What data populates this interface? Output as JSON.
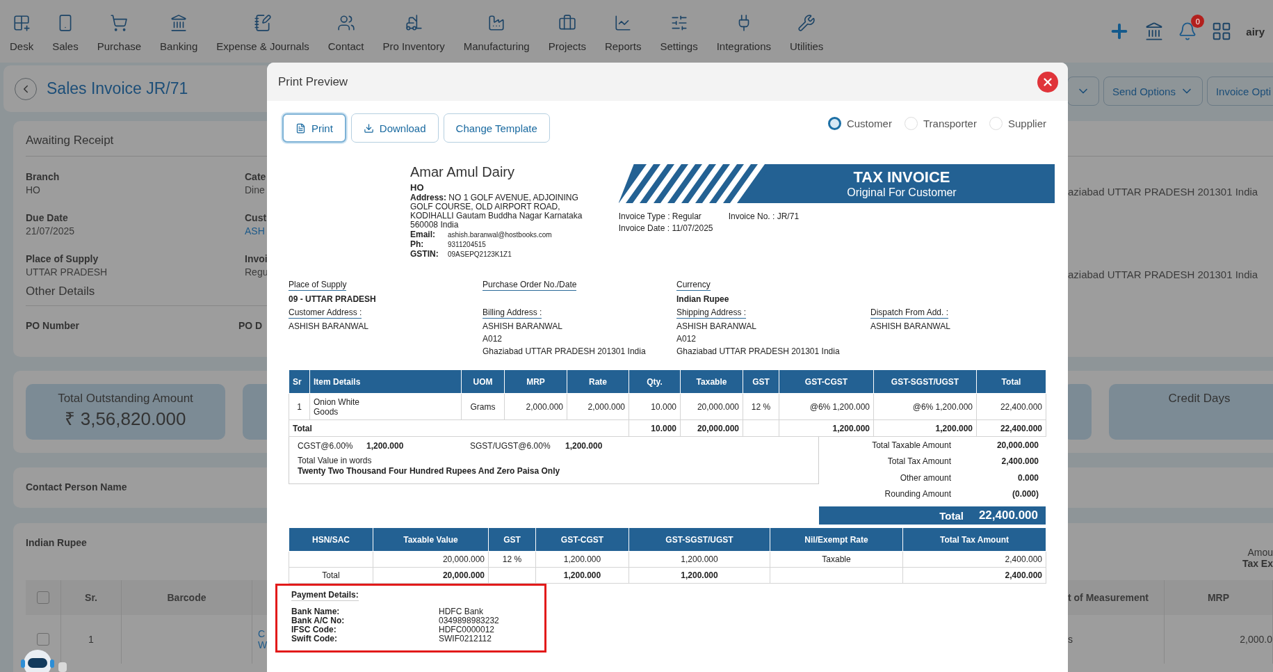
{
  "nav": {
    "items": [
      {
        "label": "Desk"
      },
      {
        "label": "Sales"
      },
      {
        "label": "Purchase"
      },
      {
        "label": "Banking"
      },
      {
        "label": "Expense & Journals"
      },
      {
        "label": "Contact"
      },
      {
        "label": "Pro Inventory"
      },
      {
        "label": "Manufacturing"
      },
      {
        "label": "Projects"
      },
      {
        "label": "Reports"
      },
      {
        "label": "Settings"
      },
      {
        "label": "Integrations"
      },
      {
        "label": "Utilities"
      }
    ],
    "notification_count": "0",
    "user": "airy"
  },
  "page": {
    "title": "Sales Invoice JR/71",
    "header_buttons": [
      "Send Options",
      "Invoice Opti"
    ],
    "details": {
      "status": "Awaiting Receipt",
      "fields": [
        {
          "label": "Branch",
          "value": "HO",
          "link": false
        },
        {
          "label": "Cate",
          "value": "Dine",
          "link": false
        },
        {
          "label": "Due Date",
          "value": "21/07/2025",
          "link": false
        },
        {
          "label": "Cust",
          "value": "ASH",
          "link": true
        },
        {
          "label": "Place of Supply",
          "value": "UTTAR PRADESH",
          "link": false
        },
        {
          "label": "Invoi",
          "value": "Regu",
          "link": false
        }
      ],
      "address_lines": [
        "aziabad UTTAR PRADESH 201301 India",
        "aziabad UTTAR PRADESH 201301 India"
      ],
      "other_details": "Other Details",
      "other_fields": [
        "PO Number",
        "PO D"
      ]
    },
    "summary_cards": [
      {
        "label": "Total Outstanding Amount",
        "value": "₹ 3,56,820.000"
      },
      {
        "label": "Credit Days"
      }
    ],
    "contact_label": "Contact Person Name",
    "currency": "Indian Rupee",
    "amount_labels": [
      "Amou",
      "Tax Ex"
    ],
    "items_table": {
      "header_checked": false,
      "left_columns": [
        "Sr.",
        "Barcode"
      ],
      "right_columns": [
        "t of Measurement",
        "MRP"
      ],
      "rows": [
        {
          "checked": false,
          "sr": "1",
          "column_3": [
            "C",
            "W"
          ],
          "right_cells": [
            "s",
            "2,000.0"
          ]
        }
      ]
    }
  },
  "modal": {
    "title": "Print Preview",
    "actions": [
      {
        "label": "Print",
        "focused": true
      },
      {
        "label": "Download",
        "focused": false
      },
      {
        "label": "Change Template",
        "focused": false
      }
    ],
    "copy_options": [
      {
        "label": "Customer",
        "selected": true
      },
      {
        "label": "Transporter",
        "selected": false
      },
      {
        "label": "Supplier",
        "selected": false
      }
    ],
    "invoice": {
      "company": {
        "name": "Amar Amul Dairy",
        "branch": "HO",
        "address": "**Address:** NO 1 GOLF AVENUE, ADJOINING GOLF COURSE, OLD AIRPORT ROAD, KODIHALLI Gautam Buddha Nagar Karnataka 560008 India",
        "contacts": [
          {
            "label": "Email:",
            "value": "ashish.baranwal@hostbooks.com"
          },
          {
            "label": "Ph:",
            "value": "9311204515"
          },
          {
            "label": "GSTIN:",
            "value": "09ASEPQ2123K1Z1"
          }
        ]
      },
      "banner": {
        "title": "TAX INVOICE",
        "subtitle": "Original For Customer"
      },
      "meta": [
        "Invoice Type : Regular",
        "Invoice No. : JR/71",
        "Invoice Date : 11/07/2025"
      ],
      "info": [
        {
          "label": "Place of Supply",
          "value": "09 - UTTAR PRADESH"
        },
        {
          "label": "Purchase Order No./Date"
        },
        {
          "label": "Currency",
          "value": "Indian Rupee"
        }
      ],
      "addresses": [
        {
          "label": "Customer Address :",
          "lines": [
            "ASHISH BARANWAL"
          ]
        },
        {
          "label": "Billing Address :",
          "lines": [
            "ASHISH BARANWAL",
            "A012",
            "Ghaziabad UTTAR PRADESH 201301 India"
          ]
        },
        {
          "label": "Shipping Address :",
          "lines": [
            "ASHISH BARANWAL",
            "A012",
            "Ghaziabad UTTAR PRADESH 201301 India"
          ]
        },
        {
          "label": "Dispatch From Add. :",
          "lines": [
            "ASHISH BARANWAL"
          ]
        }
      ],
      "items": {
        "total_label": "Total",
        "columns": [
          {
            "label": "Sr"
          },
          {
            "label": "Item Details"
          },
          {
            "label": "UOM"
          },
          {
            "label": "MRP"
          },
          {
            "label": "Rate"
          },
          {
            "label": "Qty.",
            "total": "10.000"
          },
          {
            "label": "Taxable",
            "total": "20,000.000"
          },
          {
            "label": "GST"
          },
          {
            "label": "GST-CGST",
            "total": "1,200.000"
          },
          {
            "label": "GST-SGST/UGST",
            "total": "1,200.000"
          },
          {
            "label": "Total",
            "total": "22,400.000"
          }
        ],
        "rows": [
          {
            "sr": "1",
            "item": "Onion White",
            "item_type": "Goods",
            "values": [
              "Grams",
              "2,000.000",
              "2,000.000",
              "10.000",
              "20,000.000",
              "12 %",
              "@6% 1,200.000",
              "@6% 1,200.000",
              "22,400.000"
            ]
          }
        ]
      },
      "tax_summary": [
        {
          "label": "CGST@6.00%",
          "value": "1,200.000"
        },
        {
          "label": "SGST/UGST@6.00%",
          "value": "1,200.000"
        }
      ],
      "words_label": "Total Value in words",
      "words": "Twenty Two Thousand Four Hundred Rupees And Zero Paisa Only",
      "totals": [
        {
          "label": "Total Taxable Amount",
          "value": "20,000.000"
        },
        {
          "label": "Total Tax Amount",
          "value": "2,400.000"
        },
        {
          "label": "Other amount",
          "value": "0.000"
        },
        {
          "label": "Rounding Amount",
          "value": "(0.000)"
        }
      ],
      "grand_total": {
        "label": "Total",
        "value": "22,400.000"
      },
      "hsn": {
        "columns": [
          {
            "label": "HSN/SAC",
            "total": "Total"
          },
          {
            "label": "Taxable Value",
            "value": "20,000.000",
            "total": "20,000.000"
          },
          {
            "label": "GST",
            "value": "12 %"
          },
          {
            "label": "GST-CGST",
            "value": "1,200.000",
            "total": "1,200.000"
          },
          {
            "label": "GST-SGST/UGST",
            "value": "1,200.000",
            "total": "1,200.000"
          },
          {
            "label": "Nil/Exempt Rate",
            "value": "Taxable"
          },
          {
            "label": "Total Tax Amount",
            "value": "2,400.000",
            "total": "2,400.000"
          }
        ]
      },
      "payment": {
        "title": "Payment Details:",
        "highlighted": true,
        "rows": [
          {
            "label": "Bank Name:",
            "value": "HDFC Bank"
          },
          {
            "label": "Bank A/C No:",
            "value": "0349898983232"
          },
          {
            "label": "IFSC Code:",
            "value": "HDFC0000012"
          },
          {
            "label": "Swift Code:",
            "value": "SWIF0212112"
          }
        ]
      }
    }
  }
}
